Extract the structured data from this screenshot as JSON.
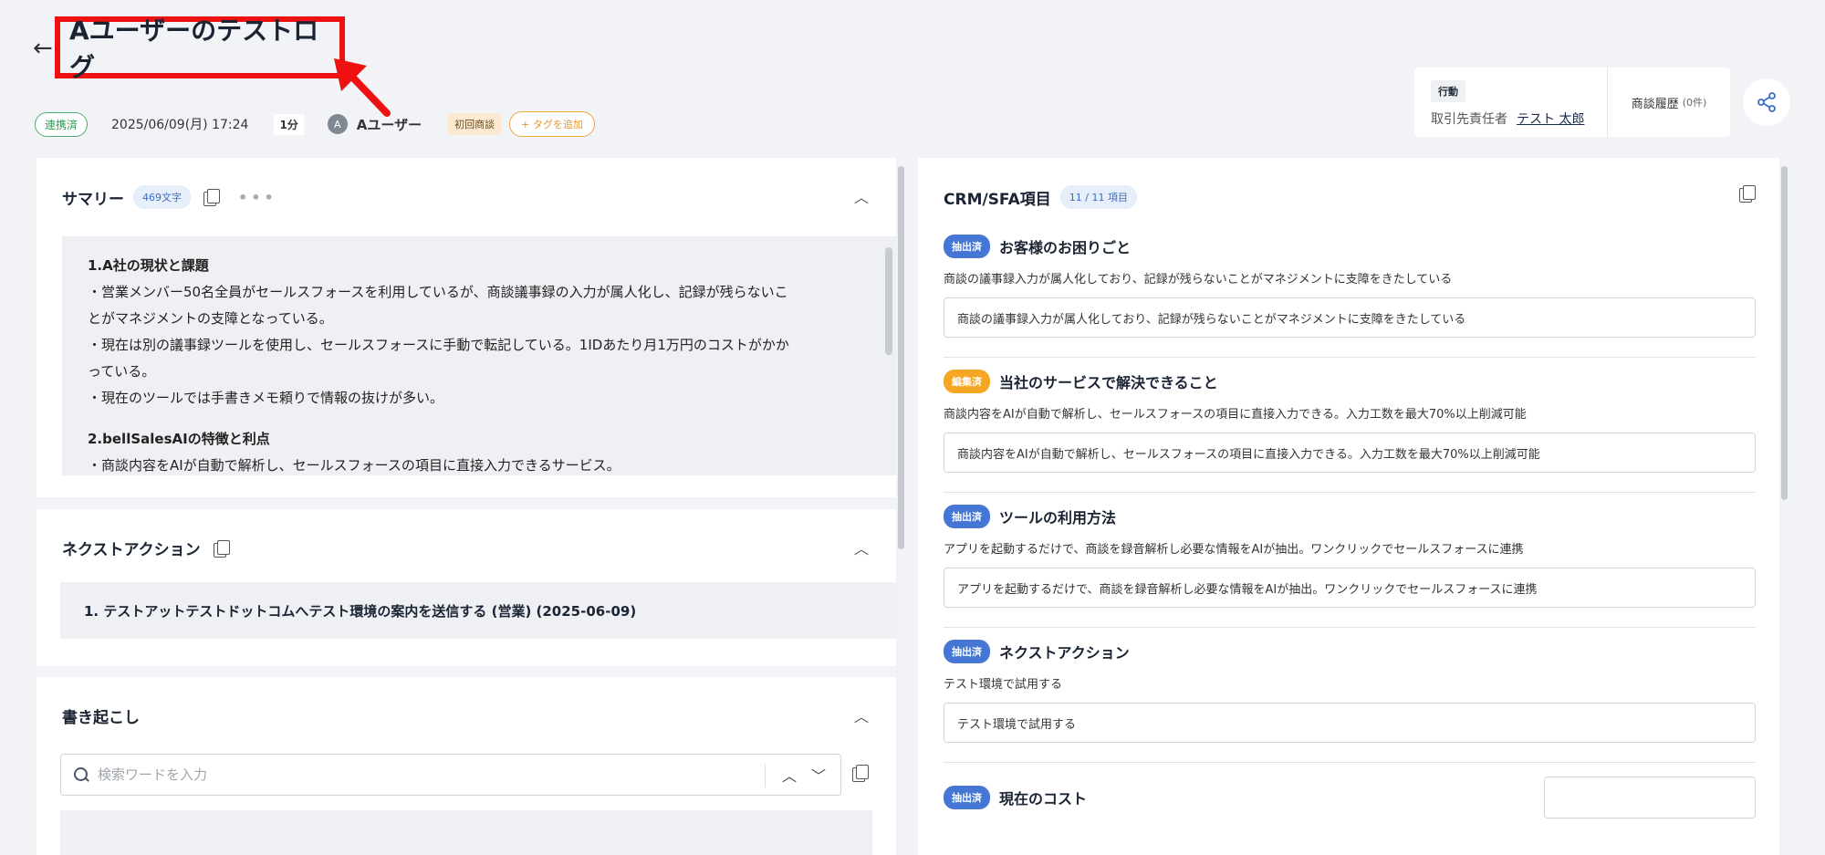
{
  "header": {
    "title": "Aユーザーのテストログ",
    "status_badge": "連携済",
    "datetime": "2025/06/09(月) 17:24",
    "duration": "1分",
    "avatar_initial": "A",
    "user_name": "Aユーザー",
    "tag": "初回商談",
    "add_tag": "+ タグを追加"
  },
  "owner_card": {
    "action_tag": "行動",
    "owner_label": "取引先責任者",
    "owner_name": "テスト 太郎",
    "history_label": "商談履歴",
    "history_count": "(0件)"
  },
  "summary": {
    "heading": "サマリー",
    "char_count": "469文字",
    "section1_title": "1.A社の現状と課題",
    "section1_lines": [
      "・営業メンバー50名全員がセールスフォースを利用しているが、商談議事録の入力が属人化し、記録が残らないこ",
      "とがマネジメントの支障となっている。",
      "・現在は別の議事録ツールを使用し、セールスフォースに手動で転記している。1IDあたり月1万円のコストがかか",
      "っている。",
      "・現在のツールでは手書きメモ頼りで情報の抜けが多い。"
    ],
    "section2_title": "2.bellSalesAIの特徴と利点",
    "section2_lines": [
      "・商談内容をAIが自動で解析し、セールスフォースの項目に直接入力できるサービス。"
    ]
  },
  "next_action": {
    "heading": "ネクストアクション",
    "item": "1. テストアットテストドットコムへテスト環境の案内を送信する (営業) (2025-06-09)"
  },
  "transcript": {
    "heading": "書き起こし",
    "search_placeholder": "検索ワードを入力"
  },
  "crm": {
    "heading": "CRM/SFA項目",
    "count": "11 / 11 項目",
    "items": [
      {
        "status": "抽出済",
        "label": "お客様のお困りごと",
        "desc": "商談の議事録入力が属人化しており、記録が残らないことがマネジメントに支障をきたしている",
        "value": "商談の議事録入力が属人化しており、記録が残らないことがマネジメントに支障をきたしている"
      },
      {
        "status": "編集済",
        "label": "当社のサービスで解決できること",
        "desc": "商談内容をAIが自動で解析し、セールスフォースの項目に直接入力できる。入力工数を最大70%以上削減可能",
        "value": "商談内容をAIが自動で解析し、セールスフォースの項目に直接入力できる。入力工数を最大70%以上削減可能"
      },
      {
        "status": "抽出済",
        "label": "ツールの利用方法",
        "desc": "アプリを起動するだけで、商談を録音解析し必要な情報をAIが抽出。ワンクリックでセールスフォースに連携",
        "value": "アプリを起動するだけで、商談を録音解析し必要な情報をAIが抽出。ワンクリックでセールスフォースに連携"
      },
      {
        "status": "抽出済",
        "label": "ネクストアクション",
        "desc": "テスト環境で試用する",
        "value": "テスト環境で試用する"
      },
      {
        "status": "抽出済",
        "label": "現在のコスト"
      }
    ]
  },
  "colors": {
    "highlight_box": "#ee1111",
    "extracted_badge": "#4576d3",
    "edited_badge": "#f5a623",
    "linked_badge": "#2e9b55"
  }
}
